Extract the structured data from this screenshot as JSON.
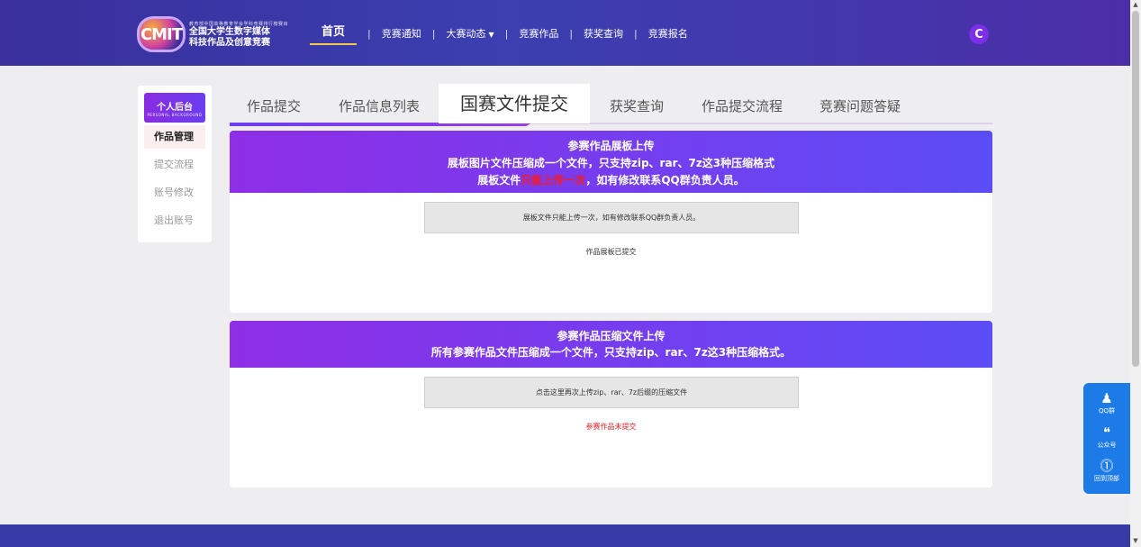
{
  "header": {
    "logo_mark": "CMIT",
    "logo_tiny": "教育部中国高等教育学会学科竞赛排行榜赛目",
    "logo_line1": "全国大学生数字媒体",
    "logo_line2": "科技作品及创意竞赛",
    "nav": [
      {
        "label": "首页"
      },
      {
        "label": "竞赛通知"
      },
      {
        "label": "大赛动态"
      },
      {
        "label": "竞赛作品"
      },
      {
        "label": "获奖查询"
      },
      {
        "label": "竞赛报名"
      }
    ],
    "avatar_letter": "C"
  },
  "sidebar": {
    "title": "个人后台",
    "subtitle": "PERSONAL BACKGROUND",
    "items": [
      {
        "label": "作品管理"
      },
      {
        "label": "提交流程"
      },
      {
        "label": "账号修改"
      },
      {
        "label": "退出账号"
      }
    ]
  },
  "tabs": [
    {
      "label": "作品提交"
    },
    {
      "label": "作品信息列表"
    },
    {
      "label": "国赛文件提交"
    },
    {
      "label": "获奖查询"
    },
    {
      "label": "作品提交流程"
    },
    {
      "label": "竞赛问题答疑"
    }
  ],
  "card1": {
    "title": "参赛作品展板上传",
    "line2": "展板图片文件压缩成一个文件，只支持zip、rar、7z这3种压缩格式",
    "line3_prefix": "展板文件",
    "line3_red": "只能上传一次",
    "line3_suffix": "，如有修改联系QQ群负责人员。",
    "upload_text": "展板文件只能上传一次，如有修改联系QQ群负责人员。",
    "status": "作品展板已提交"
  },
  "card2": {
    "title": "参赛作品压缩文件上传",
    "line2": "所有参赛作品文件压缩成一个文件，只支持zip、rar、7z这3种压缩格式。",
    "upload_text": "点击这里再次上传zip、rar、7z后缀的压缩文件",
    "status": "参赛作品未提交"
  },
  "float": {
    "items": [
      {
        "label": "QQ群"
      },
      {
        "label": "公众号"
      },
      {
        "label": "回到顶部"
      }
    ]
  },
  "colors": {
    "header_bg": "#3b3fb0",
    "card_head": "#7140f0",
    "accent_red": "#ff1a1a",
    "float_bg": "#1d7be8"
  }
}
